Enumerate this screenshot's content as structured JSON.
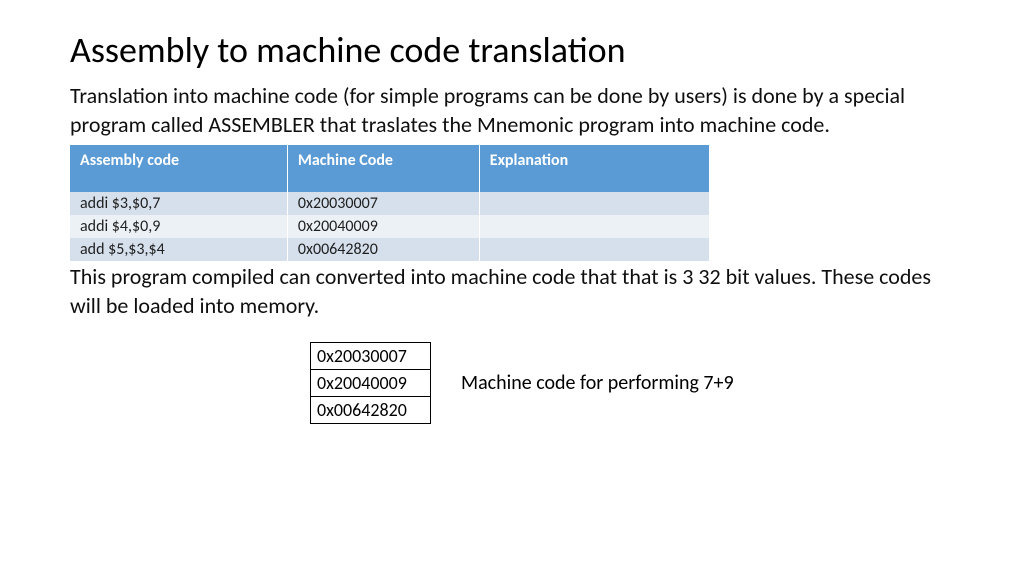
{
  "title": "Assembly to machine code translation",
  "intro": "Translation into machine code (for simple programs can be done by users) is done by a special program called ASSEMBLER that traslates the Mnemonic program into machine code.",
  "table": {
    "headers": {
      "assembly": "Assembly code",
      "machine": "Machine Code",
      "explain": "Explanation"
    },
    "rows": [
      {
        "assembly": "addi $3,$0,7",
        "machine": "0x20030007",
        "explain": ""
      },
      {
        "assembly": "addi $4,$0,9",
        "machine": "0x20040009",
        "explain": ""
      },
      {
        "assembly": "add $5,$3,$4",
        "machine": "0x00642820",
        "explain": ""
      }
    ]
  },
  "outro": "This program compiled can converted into machine code that  that is 3 32 bit values.  These codes will be loaded into memory.",
  "mcode": [
    "0x20030007",
    "0x20040009",
    "0x00642820"
  ],
  "mcode_label": "Machine code for performing  7+9"
}
